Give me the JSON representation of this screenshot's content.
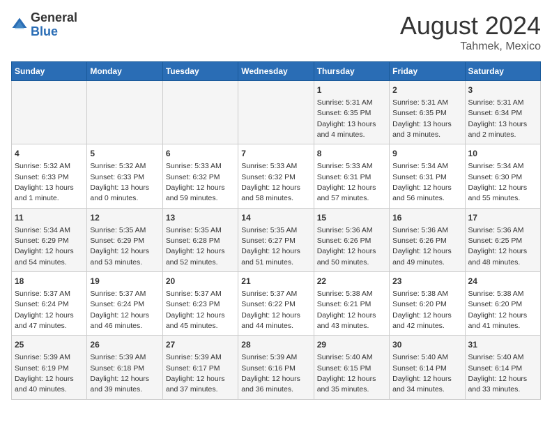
{
  "logo": {
    "general": "General",
    "blue": "Blue"
  },
  "title": "August 2024",
  "subtitle": "Tahmek, Mexico",
  "days_of_week": [
    "Sunday",
    "Monday",
    "Tuesday",
    "Wednesday",
    "Thursday",
    "Friday",
    "Saturday"
  ],
  "weeks": [
    [
      {
        "day": "",
        "info": ""
      },
      {
        "day": "",
        "info": ""
      },
      {
        "day": "",
        "info": ""
      },
      {
        "day": "",
        "info": ""
      },
      {
        "day": "1",
        "info": "Sunrise: 5:31 AM\nSunset: 6:35 PM\nDaylight: 13 hours\nand 4 minutes."
      },
      {
        "day": "2",
        "info": "Sunrise: 5:31 AM\nSunset: 6:35 PM\nDaylight: 13 hours\nand 3 minutes."
      },
      {
        "day": "3",
        "info": "Sunrise: 5:31 AM\nSunset: 6:34 PM\nDaylight: 13 hours\nand 2 minutes."
      }
    ],
    [
      {
        "day": "4",
        "info": "Sunrise: 5:32 AM\nSunset: 6:33 PM\nDaylight: 13 hours\nand 1 minute."
      },
      {
        "day": "5",
        "info": "Sunrise: 5:32 AM\nSunset: 6:33 PM\nDaylight: 13 hours\nand 0 minutes."
      },
      {
        "day": "6",
        "info": "Sunrise: 5:33 AM\nSunset: 6:32 PM\nDaylight: 12 hours\nand 59 minutes."
      },
      {
        "day": "7",
        "info": "Sunrise: 5:33 AM\nSunset: 6:32 PM\nDaylight: 12 hours\nand 58 minutes."
      },
      {
        "day": "8",
        "info": "Sunrise: 5:33 AM\nSunset: 6:31 PM\nDaylight: 12 hours\nand 57 minutes."
      },
      {
        "day": "9",
        "info": "Sunrise: 5:34 AM\nSunset: 6:31 PM\nDaylight: 12 hours\nand 56 minutes."
      },
      {
        "day": "10",
        "info": "Sunrise: 5:34 AM\nSunset: 6:30 PM\nDaylight: 12 hours\nand 55 minutes."
      }
    ],
    [
      {
        "day": "11",
        "info": "Sunrise: 5:34 AM\nSunset: 6:29 PM\nDaylight: 12 hours\nand 54 minutes."
      },
      {
        "day": "12",
        "info": "Sunrise: 5:35 AM\nSunset: 6:29 PM\nDaylight: 12 hours\nand 53 minutes."
      },
      {
        "day": "13",
        "info": "Sunrise: 5:35 AM\nSunset: 6:28 PM\nDaylight: 12 hours\nand 52 minutes."
      },
      {
        "day": "14",
        "info": "Sunrise: 5:35 AM\nSunset: 6:27 PM\nDaylight: 12 hours\nand 51 minutes."
      },
      {
        "day": "15",
        "info": "Sunrise: 5:36 AM\nSunset: 6:26 PM\nDaylight: 12 hours\nand 50 minutes."
      },
      {
        "day": "16",
        "info": "Sunrise: 5:36 AM\nSunset: 6:26 PM\nDaylight: 12 hours\nand 49 minutes."
      },
      {
        "day": "17",
        "info": "Sunrise: 5:36 AM\nSunset: 6:25 PM\nDaylight: 12 hours\nand 48 minutes."
      }
    ],
    [
      {
        "day": "18",
        "info": "Sunrise: 5:37 AM\nSunset: 6:24 PM\nDaylight: 12 hours\nand 47 minutes."
      },
      {
        "day": "19",
        "info": "Sunrise: 5:37 AM\nSunset: 6:24 PM\nDaylight: 12 hours\nand 46 minutes."
      },
      {
        "day": "20",
        "info": "Sunrise: 5:37 AM\nSunset: 6:23 PM\nDaylight: 12 hours\nand 45 minutes."
      },
      {
        "day": "21",
        "info": "Sunrise: 5:37 AM\nSunset: 6:22 PM\nDaylight: 12 hours\nand 44 minutes."
      },
      {
        "day": "22",
        "info": "Sunrise: 5:38 AM\nSunset: 6:21 PM\nDaylight: 12 hours\nand 43 minutes."
      },
      {
        "day": "23",
        "info": "Sunrise: 5:38 AM\nSunset: 6:20 PM\nDaylight: 12 hours\nand 42 minutes."
      },
      {
        "day": "24",
        "info": "Sunrise: 5:38 AM\nSunset: 6:20 PM\nDaylight: 12 hours\nand 41 minutes."
      }
    ],
    [
      {
        "day": "25",
        "info": "Sunrise: 5:39 AM\nSunset: 6:19 PM\nDaylight: 12 hours\nand 40 minutes."
      },
      {
        "day": "26",
        "info": "Sunrise: 5:39 AM\nSunset: 6:18 PM\nDaylight: 12 hours\nand 39 minutes."
      },
      {
        "day": "27",
        "info": "Sunrise: 5:39 AM\nSunset: 6:17 PM\nDaylight: 12 hours\nand 37 minutes."
      },
      {
        "day": "28",
        "info": "Sunrise: 5:39 AM\nSunset: 6:16 PM\nDaylight: 12 hours\nand 36 minutes."
      },
      {
        "day": "29",
        "info": "Sunrise: 5:40 AM\nSunset: 6:15 PM\nDaylight: 12 hours\nand 35 minutes."
      },
      {
        "day": "30",
        "info": "Sunrise: 5:40 AM\nSunset: 6:14 PM\nDaylight: 12 hours\nand 34 minutes."
      },
      {
        "day": "31",
        "info": "Sunrise: 5:40 AM\nSunset: 6:14 PM\nDaylight: 12 hours\nand 33 minutes."
      }
    ]
  ]
}
